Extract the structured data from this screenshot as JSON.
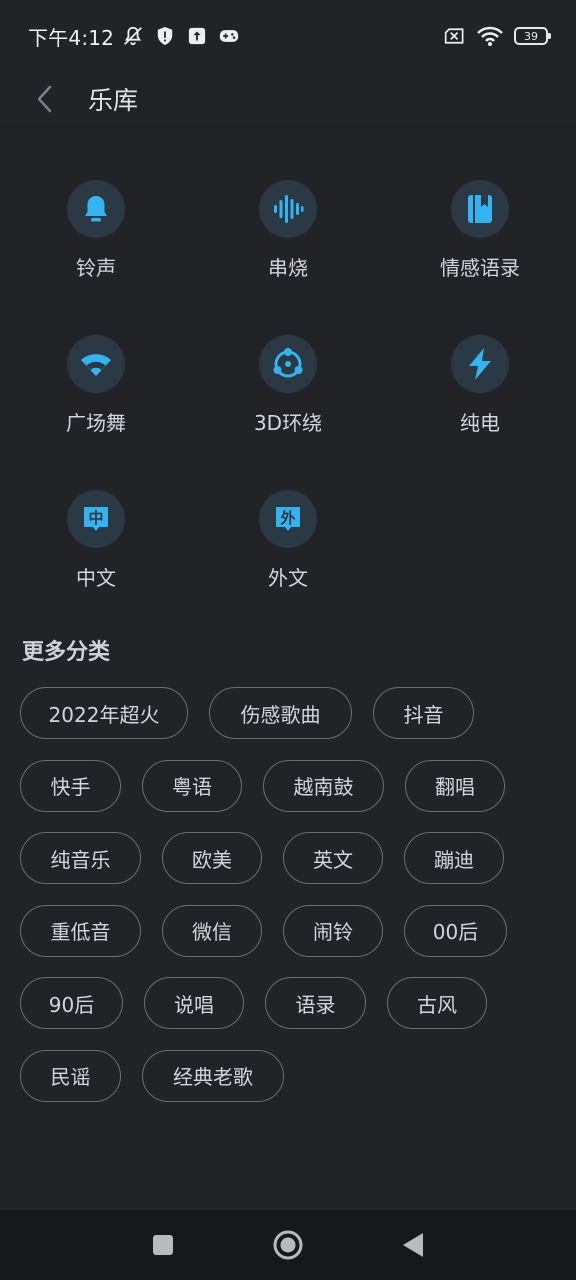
{
  "status_bar": {
    "time": "下午4:12",
    "battery": "39",
    "left_icons": [
      "mute-bell-icon",
      "shield-icon",
      "upload-icon",
      "gamepad-icon"
    ],
    "right_icons": [
      "sim-off-icon",
      "wifi-icon",
      "battery-icon"
    ]
  },
  "header": {
    "title": "乐库",
    "back_icon": "chevron-left-icon"
  },
  "grid": {
    "accent_color": "#35b3f0",
    "icon_bg": "#2b3944",
    "items": [
      {
        "label": "铃声",
        "icon": "bell-icon"
      },
      {
        "label": "串烧",
        "icon": "soundwave-icon"
      },
      {
        "label": "情感语录",
        "icon": "book-icon"
      },
      {
        "label": "广场舞",
        "icon": "fan-icon"
      },
      {
        "label": "3D环绕",
        "icon": "surround-icon"
      },
      {
        "label": "纯电",
        "icon": "lightning-icon"
      },
      {
        "label": "中文",
        "icon": "chinese-char-icon",
        "glyph": "中"
      },
      {
        "label": "外文",
        "icon": "foreign-char-icon",
        "glyph": "外"
      }
    ]
  },
  "more": {
    "title": "更多分类",
    "tag_rows": [
      [
        "2022年超火",
        "伤感歌曲",
        "抖音"
      ],
      [
        "快手",
        "粤语",
        "越南鼓",
        "翻唱"
      ],
      [
        "纯音乐",
        "欧美",
        "英文",
        "蹦迪"
      ],
      [
        "重低音",
        "微信",
        "闹铃",
        "00后"
      ],
      [
        "90后",
        "说唱",
        "语录",
        "古风"
      ],
      [
        "民谣",
        "经典老歌"
      ]
    ]
  },
  "nav_bar": {
    "icons": [
      "recents-square-icon",
      "home-circle-icon",
      "back-triangle-icon"
    ]
  }
}
